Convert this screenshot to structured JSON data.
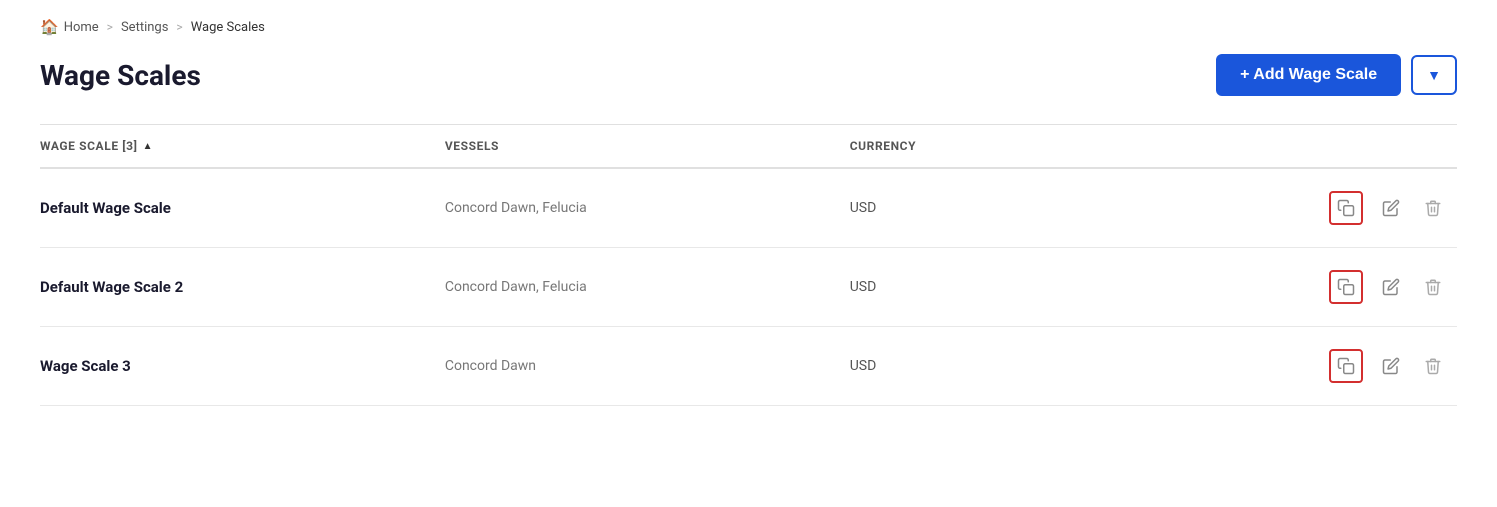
{
  "breadcrumb": {
    "home_label": "Home",
    "home_icon": "🏠",
    "sep": ">",
    "settings_label": "Settings",
    "current_label": "Wage Scales"
  },
  "page": {
    "title": "Wage Scales"
  },
  "toolbar": {
    "add_button_label": "+ Add Wage Scale",
    "filter_icon": "▼"
  },
  "table": {
    "columns": [
      {
        "key": "wage_scale",
        "label": "WAGE SCALE [3]",
        "sortable": true
      },
      {
        "key": "vessels",
        "label": "VESSELS",
        "sortable": false
      },
      {
        "key": "currency",
        "label": "CURRENCY",
        "sortable": false
      },
      {
        "key": "actions",
        "label": "",
        "sortable": false
      }
    ],
    "rows": [
      {
        "name": "Default Wage Scale",
        "vessels": "Concord Dawn, Felucia",
        "currency": "USD"
      },
      {
        "name": "Default Wage Scale 2",
        "vessels": "Concord Dawn, Felucia",
        "currency": "USD"
      },
      {
        "name": "Wage Scale 3",
        "vessels": "Concord Dawn",
        "currency": "USD"
      }
    ]
  },
  "icons": {
    "copy": "📋",
    "edit": "✎",
    "delete": "🗑"
  },
  "colors": {
    "primary": "#1a56db",
    "danger_border": "#d32f2f"
  }
}
